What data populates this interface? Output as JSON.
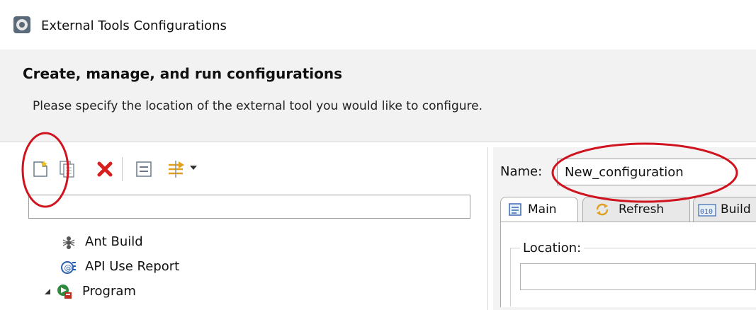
{
  "window": {
    "title": "External Tools Configurations",
    "icon": "gear-icon"
  },
  "header": {
    "heading": "Create, manage, and run configurations",
    "message": "Please specify the location of the external tool you would like to configure."
  },
  "toolbar": {
    "buttons": [
      "new-configuration-icon",
      "duplicate-icon",
      "delete-icon",
      "collapse-all-icon",
      "filter-icon",
      "chevron-down-icon"
    ]
  },
  "filter": {
    "value": "",
    "placeholder": ""
  },
  "tree": {
    "items": [
      {
        "label": "Ant Build",
        "icon": "ant-icon"
      },
      {
        "label": "API Use Report",
        "icon": "api-report-icon"
      },
      {
        "label": "Program",
        "icon": "program-icon",
        "expanded": true
      }
    ]
  },
  "config": {
    "name_label": "Name:",
    "name_value": "New_configuration",
    "tabs": [
      {
        "label": "Main",
        "icon": "main-tab-icon",
        "active": true
      },
      {
        "label": "Refresh",
        "icon": "refresh-icon"
      },
      {
        "label": "Build",
        "icon": "build-icon"
      }
    ],
    "location_label": "Location:",
    "location_value": ""
  },
  "colors": {
    "annotation": "#d0141f",
    "delete": "#d81e1e"
  }
}
